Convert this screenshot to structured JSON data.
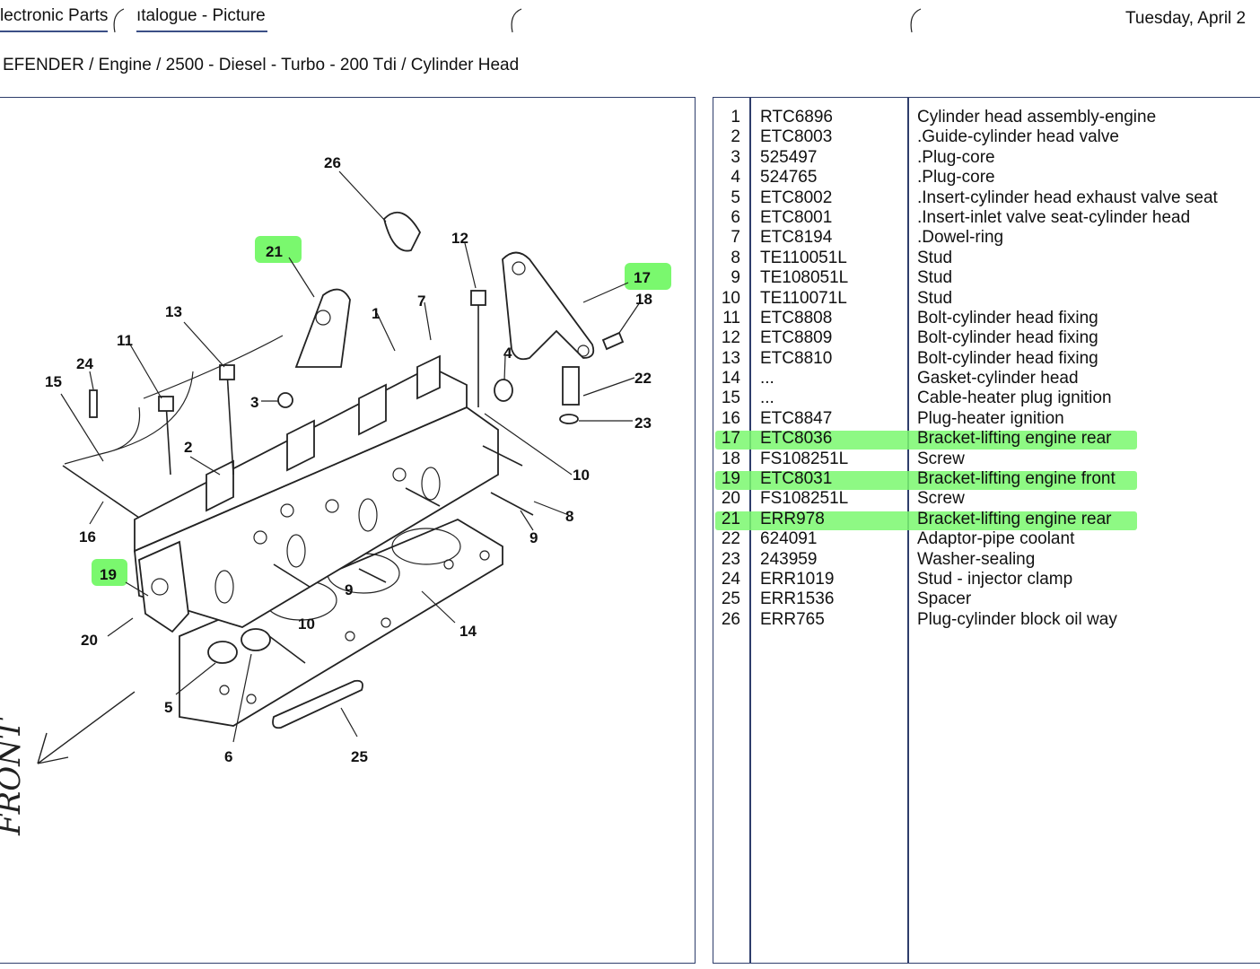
{
  "header": {
    "tab1": "lectronic Parts",
    "tab2": "ıtalogue - Picture",
    "date": "Tuesday, April 2",
    "breadcrumb": "EFENDER / Engine / 2500 - Diesel - Turbo - 200 Tdi / Cylinder Head"
  },
  "diagram": {
    "callouts": [
      "26",
      "21",
      "12",
      "17",
      "18",
      "13",
      "1",
      "7",
      "11",
      "24",
      "4",
      "15",
      "3",
      "22",
      "23",
      "2",
      "10",
      "8",
      "9",
      "16",
      "19",
      "9",
      "20",
      "10",
      "14",
      "5",
      "6",
      "25"
    ],
    "handwriting": "FRONT",
    "highlight_color": "#7af86e"
  },
  "parts": [
    {
      "no": "1",
      "part": "RTC6896",
      "desc": "Cylinder head assembly-engine",
      "hl": false
    },
    {
      "no": "2",
      "part": "ETC8003",
      "desc": ".Guide-cylinder head valve",
      "hl": false
    },
    {
      "no": "3",
      "part": "525497",
      "desc": ".Plug-core",
      "hl": false
    },
    {
      "no": "4",
      "part": "524765",
      "desc": ".Plug-core",
      "hl": false
    },
    {
      "no": "5",
      "part": "ETC8002",
      "desc": ".Insert-cylinder head exhaust valve seat",
      "hl": false
    },
    {
      "no": "6",
      "part": "ETC8001",
      "desc": ".Insert-inlet valve seat-cylinder head",
      "hl": false
    },
    {
      "no": "7",
      "part": "ETC8194",
      "desc": ".Dowel-ring",
      "hl": false
    },
    {
      "no": "8",
      "part": "TE110051L",
      "desc": "Stud",
      "hl": false
    },
    {
      "no": "9",
      "part": "TE108051L",
      "desc": "Stud",
      "hl": false
    },
    {
      "no": "10",
      "part": "TE110071L",
      "desc": "Stud",
      "hl": false
    },
    {
      "no": "11",
      "part": "ETC8808",
      "desc": "Bolt-cylinder head fixing",
      "hl": false
    },
    {
      "no": "12",
      "part": "ETC8809",
      "desc": "Bolt-cylinder head fixing",
      "hl": false
    },
    {
      "no": "13",
      "part": "ETC8810",
      "desc": "Bolt-cylinder head fixing",
      "hl": false
    },
    {
      "no": "14",
      "part": "...",
      "desc": "Gasket-cylinder head",
      "hl": false
    },
    {
      "no": "15",
      "part": "...",
      "desc": "Cable-heater plug ignition",
      "hl": false
    },
    {
      "no": "16",
      "part": "ETC8847",
      "desc": "Plug-heater ignition",
      "hl": false
    },
    {
      "no": "17",
      "part": "ETC8036",
      "desc": "Bracket-lifting engine rear",
      "hl": true
    },
    {
      "no": "18",
      "part": "FS108251L",
      "desc": "Screw",
      "hl": false
    },
    {
      "no": "19",
      "part": "ETC8031",
      "desc": "Bracket-lifting engine front",
      "hl": true
    },
    {
      "no": "20",
      "part": "FS108251L",
      "desc": "Screw",
      "hl": false
    },
    {
      "no": "21",
      "part": "ERR978",
      "desc": "Bracket-lifting engine rear",
      "hl": true
    },
    {
      "no": "22",
      "part": "624091",
      "desc": "Adaptor-pipe coolant",
      "hl": false
    },
    {
      "no": "23",
      "part": "243959",
      "desc": "Washer-sealing",
      "hl": false
    },
    {
      "no": "24",
      "part": "ERR1019",
      "desc": "Stud - injector clamp",
      "hl": false
    },
    {
      "no": "25",
      "part": "ERR1536",
      "desc": "Spacer",
      "hl": false
    },
    {
      "no": "26",
      "part": "ERR765",
      "desc": "Plug-cylinder block oil way",
      "hl": false
    }
  ]
}
